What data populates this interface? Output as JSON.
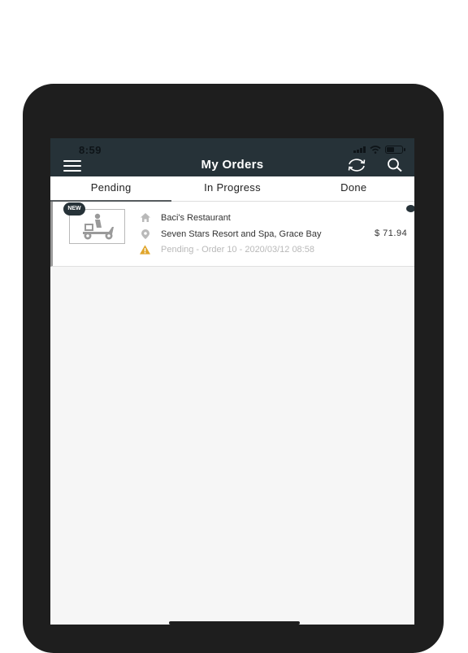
{
  "status_bar": {
    "time": "8:59"
  },
  "header": {
    "title": "My Orders"
  },
  "tabs": [
    {
      "label": "Pending",
      "active": true
    },
    {
      "label": "In Progress",
      "active": false
    },
    {
      "label": "Done",
      "active": false
    }
  ],
  "orders": [
    {
      "badge": "NEW",
      "restaurant": "Baci's Restaurant",
      "address": "Seven Stars Resort and Spa, Grace Bay",
      "status_line": "Pending - Order 10 - 2020/03/12 08:58",
      "price": "$ 71.94",
      "icons": {
        "restaurant": "home-icon",
        "address": "location-pin-icon",
        "status": "warning-icon",
        "thumbnail": "delivery-scooter-icon"
      }
    }
  ],
  "colors": {
    "header_bg": "#263238",
    "warning": "#e0a52b",
    "muted": "#b9b9b9"
  }
}
